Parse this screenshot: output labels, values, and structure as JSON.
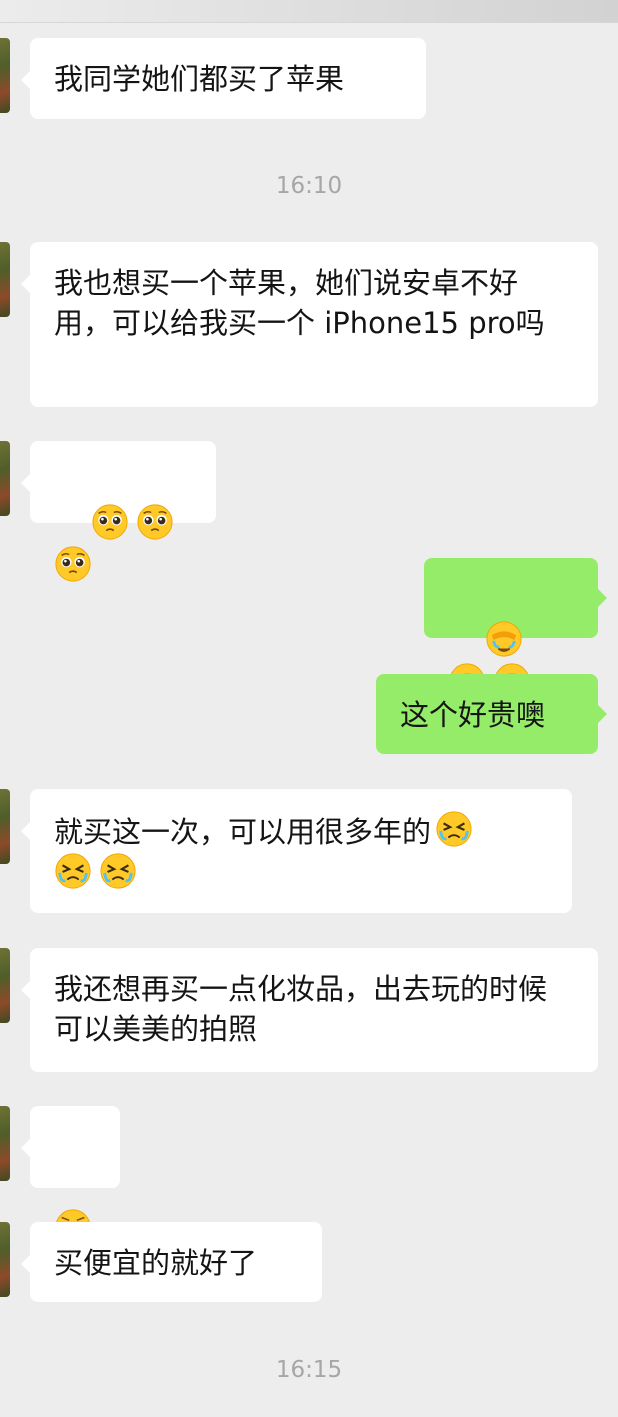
{
  "messages": [
    {
      "sender": "other",
      "text": "我同学她们都买了苹果"
    },
    {
      "timestamp": "16:10"
    },
    {
      "sender": "other",
      "text": "我也想买一个苹果，她们说安卓不好用，可以给我买一个 iPhone15 pro吗"
    },
    {
      "sender": "other",
      "emojis": [
        "pleading-face",
        "pleading-face",
        "pleading-face"
      ]
    },
    {
      "sender": "me",
      "emojis": [
        "facepalm-crying",
        "facepalm-crying",
        "facepalm-crying"
      ]
    },
    {
      "sender": "me",
      "text": "这个好贵噢"
    },
    {
      "sender": "other",
      "text": "就买这一次，可以用很多年的",
      "emojis": [
        "squinting-crying-face",
        "squinting-crying-face",
        "squinting-crying-face"
      ]
    },
    {
      "sender": "other",
      "text": "我还想再买一点化妆品，出去玩的时候可以美美的拍照"
    },
    {
      "sender": "other",
      "emojis": [
        "pouting-face"
      ]
    },
    {
      "sender": "other",
      "text": "买便宜的就好了"
    },
    {
      "timestamp": "16:15"
    }
  ],
  "colors": {
    "background": "#ededed",
    "bubble_other": "#ffffff",
    "bubble_me": "#95ec69",
    "timestamp_text": "#a6a6a6"
  }
}
